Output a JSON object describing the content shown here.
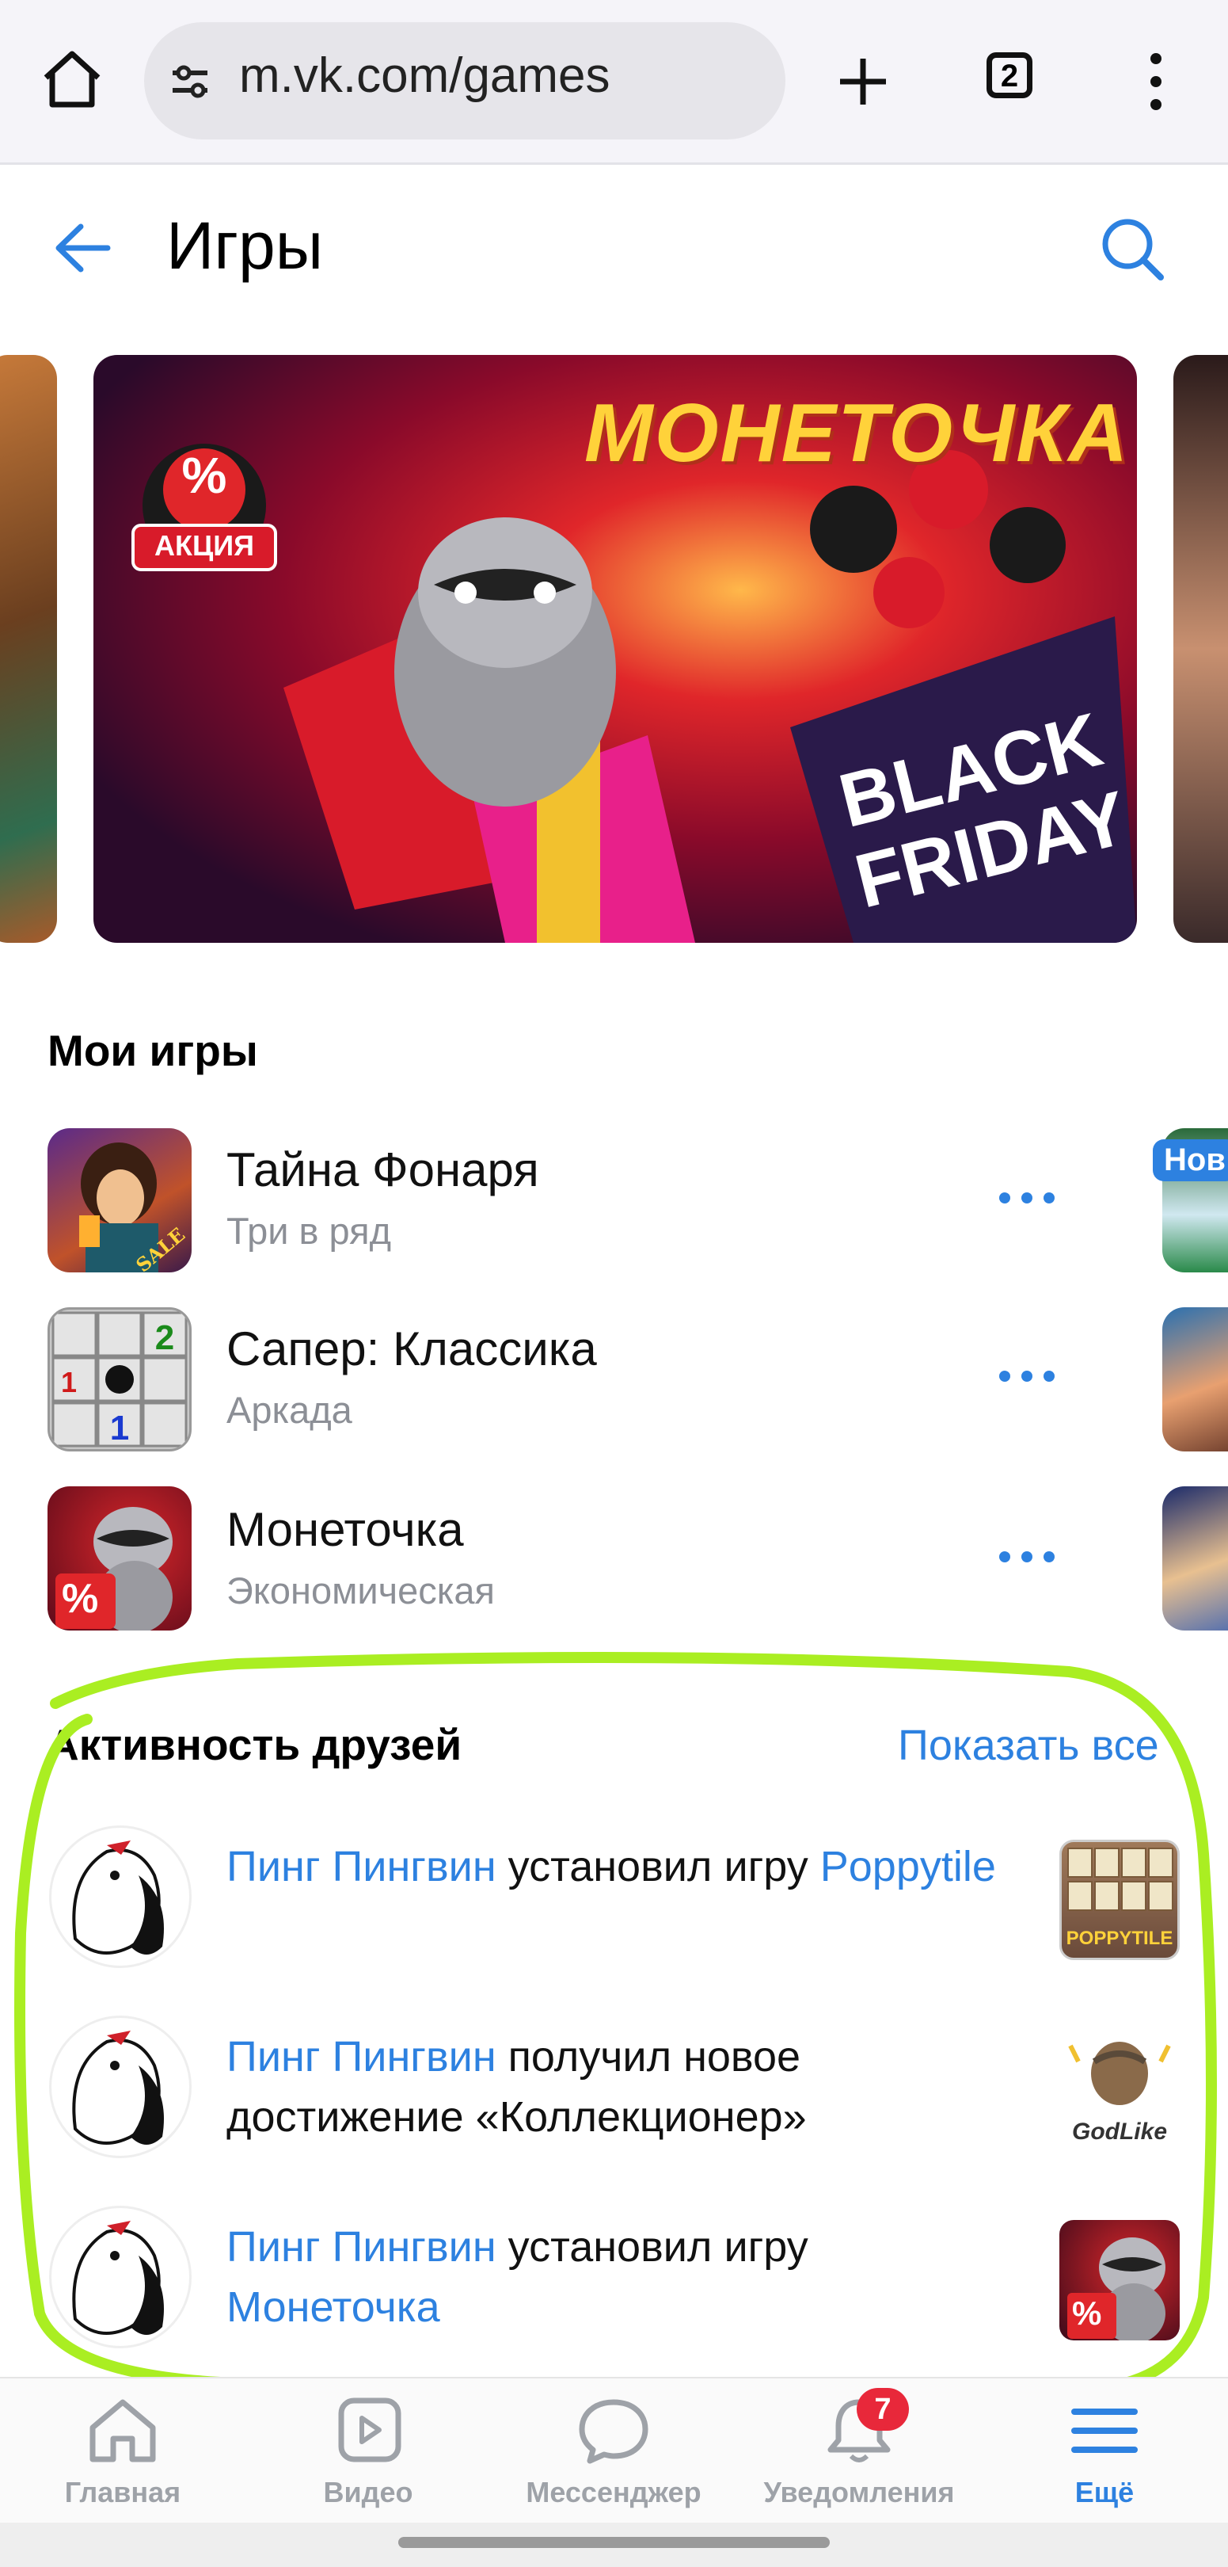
{
  "browser": {
    "url": "m.vk.com/games",
    "tab_count": "2"
  },
  "header": {
    "title": "Игры"
  },
  "banners": {
    "main": {
      "logo_text": "МОНЕТОЧКА",
      "promo_badge": "АКЦИЯ",
      "promo_symbol": "%",
      "sale_text_line1": "BLACK",
      "sale_text_line2": "FRIDAY"
    }
  },
  "my_games": {
    "title": "Мои игры",
    "items": [
      {
        "name": "Тайна Фонаря",
        "genre": "Три в ряд",
        "icon_badge": "SALE"
      },
      {
        "name": "Сапер: Классика",
        "genre": "Аркада"
      },
      {
        "name": "Монеточка",
        "genre": "Экономическая"
      }
    ],
    "side_badge": "Нов"
  },
  "friends_activity": {
    "title": "Активность друзей",
    "show_all": "Показать все",
    "items": [
      {
        "friend": "Пинг Пингвин",
        "action": " установил игру ",
        "target": "Poppytile",
        "thumb_text": "POPPYTILE"
      },
      {
        "friend": "Пинг Пингвин",
        "action": " получил новое достижение «Коллекционер»",
        "target": "",
        "thumb_text": "GodLike"
      },
      {
        "friend": "Пинг Пингвин",
        "action": " установил игру ",
        "target": "Монеточка",
        "thumb_text": "%"
      }
    ]
  },
  "bottom_nav": {
    "items": [
      {
        "label": "Главная",
        "icon": "home-icon"
      },
      {
        "label": "Видео",
        "icon": "video-icon"
      },
      {
        "label": "Мессенджер",
        "icon": "messenger-icon"
      },
      {
        "label": "Уведомления",
        "icon": "bell-icon",
        "badge": "7"
      },
      {
        "label": "Ещё",
        "icon": "menu-icon",
        "active": true
      }
    ]
  },
  "colors": {
    "accent": "#2d81e0",
    "annotation": "#aaee22"
  }
}
